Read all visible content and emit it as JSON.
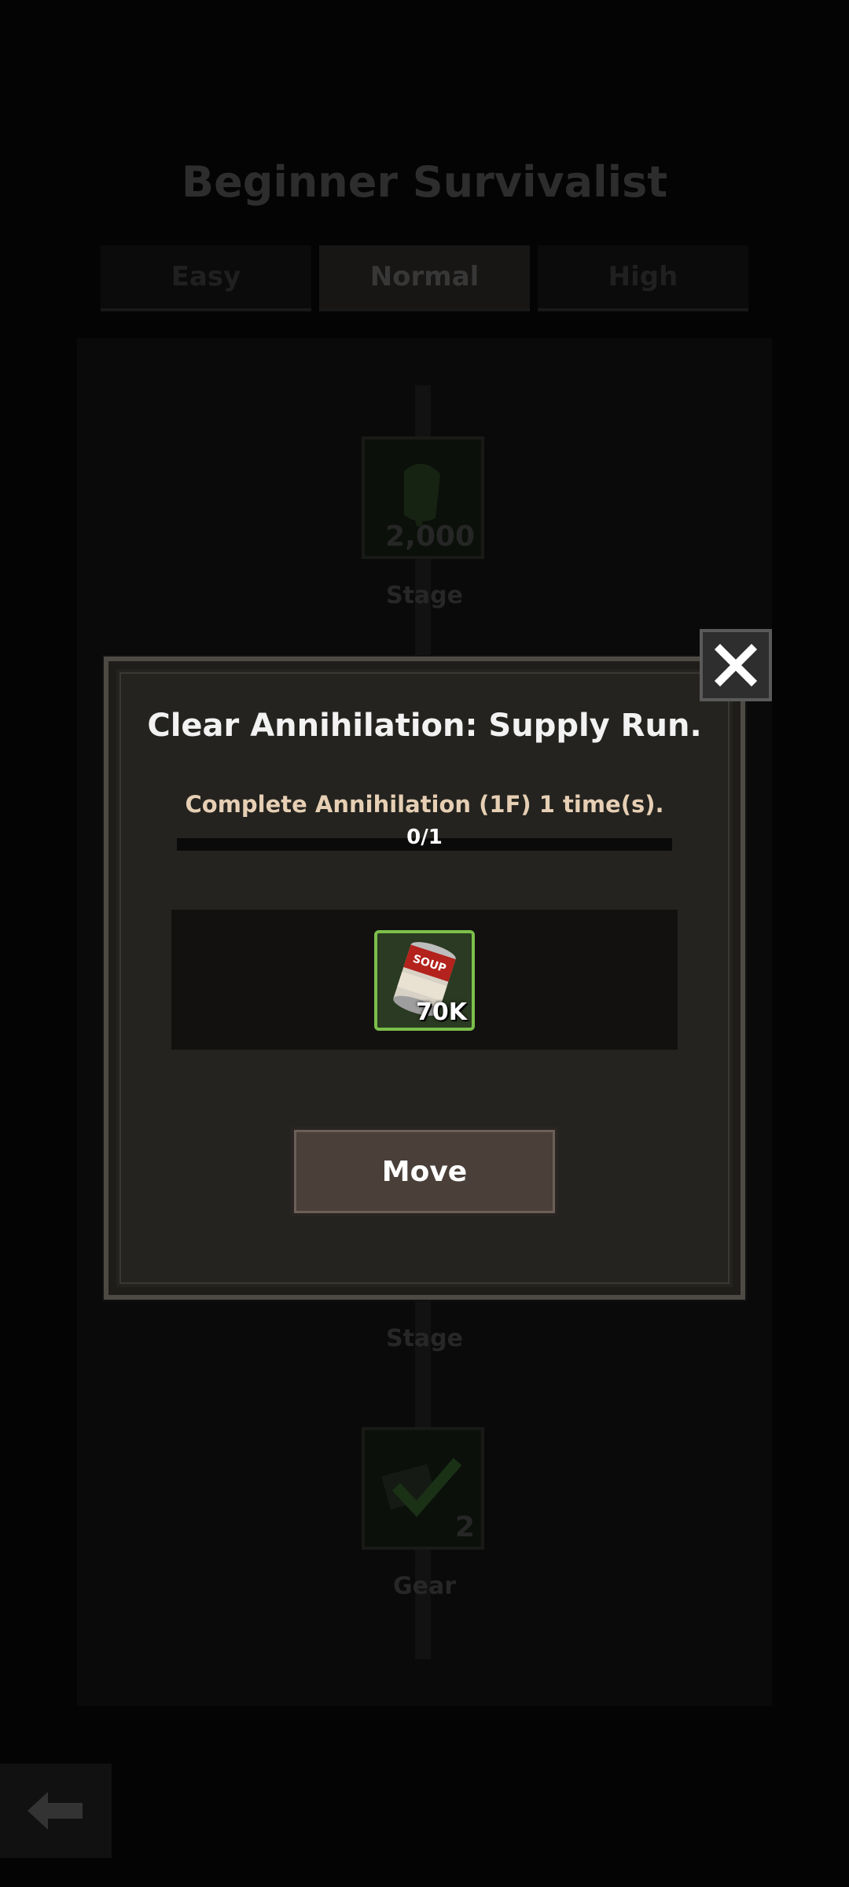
{
  "background": {
    "title": "Beginner Survivalist",
    "tabs": [
      {
        "label": "Easy",
        "active": false
      },
      {
        "label": "Normal",
        "active": true
      },
      {
        "label": "High",
        "active": false
      }
    ],
    "nodes": [
      {
        "label": "Stage",
        "count": "2,000",
        "icon": "stage-reward-icon"
      },
      {
        "label": "Stage",
        "count": "",
        "icon": "stage-icon"
      },
      {
        "label": "Gear",
        "count": "2",
        "icon": "gear-check-icon"
      }
    ],
    "back_icon": "back-arrow-icon"
  },
  "modal": {
    "title": "Clear Annihilation: Supply Run.",
    "description": "Complete Annihilation (1F) 1 time(s).",
    "progress_text": "0/1",
    "progress_fraction": 0.0,
    "reward": {
      "icon": "soup-can-icon",
      "quantity": "70K",
      "can_label": "SOUP"
    },
    "move_label": "Move",
    "close_icon": "close-icon"
  },
  "colors": {
    "modal_bg": "#24231f",
    "reward_border": "#7bbf4a",
    "description_text": "#e6cfb4",
    "move_button": "#4a3f39"
  }
}
